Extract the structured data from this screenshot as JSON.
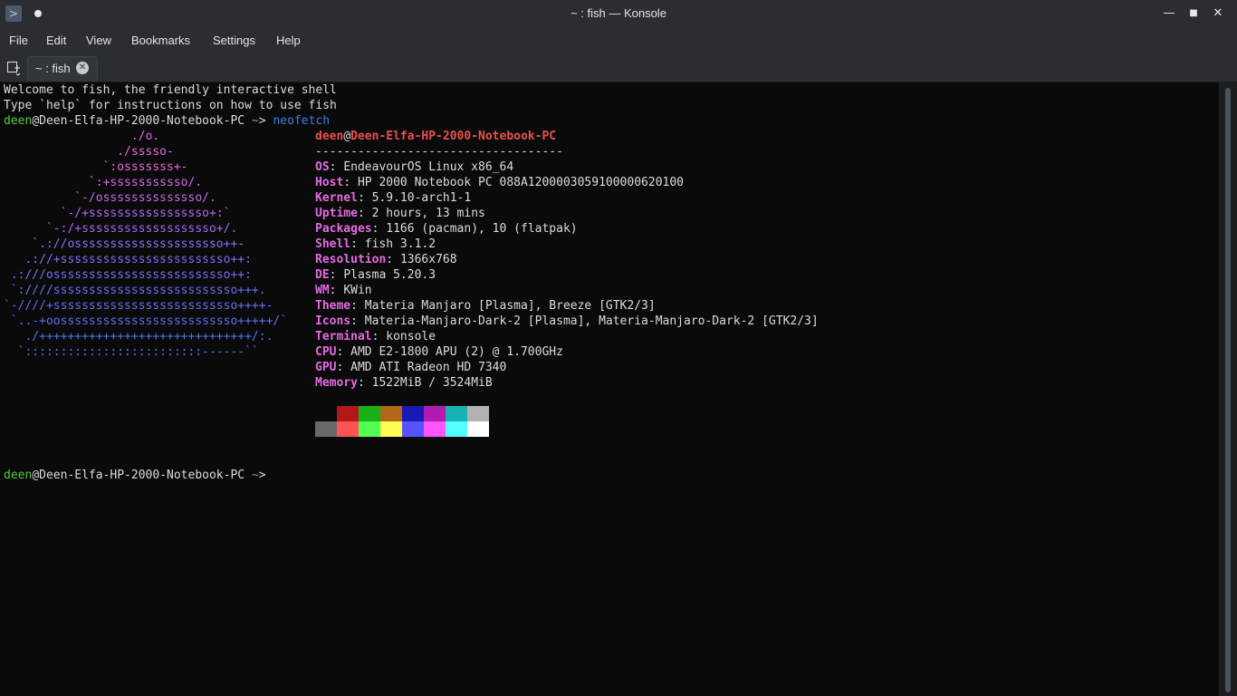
{
  "window": {
    "title": "~ : fish — Konsole",
    "minimize_glyph": "—",
    "maximize_glyph": "■",
    "close_glyph": "✕",
    "app_icon_glyph": ">"
  },
  "menubar": {
    "items": [
      {
        "label": "File"
      },
      {
        "label": "Edit"
      },
      {
        "label": "View"
      },
      {
        "label": "Bookmarks"
      },
      {
        "label": "Settings"
      },
      {
        "label": "Help"
      }
    ]
  },
  "tabs": [
    {
      "label": "~ : fish",
      "close_glyph": "✕"
    }
  ],
  "terminal": {
    "welcome_1": "Welcome to fish, the friendly interactive shell",
    "welcome_2": "Type `help` for instructions on how to use fish",
    "prompt_user": "deen",
    "prompt_host": "@Deen-Elfa-HP-2000-Notebook-PC",
    "prompt_dir": " ~",
    "prompt_symbol": "> ",
    "command": "neofetch",
    "neofetch": {
      "user": "deen",
      "at": "@",
      "host": "Deen-Elfa-HP-2000-Notebook-PC",
      "separator": "-----------------------------------",
      "fields": [
        {
          "key": "OS",
          "value": "EndeavourOS Linux x86_64"
        },
        {
          "key": "Host",
          "value": "HP 2000 Notebook PC 088A1200003059100000620100"
        },
        {
          "key": "Kernel",
          "value": "5.9.10-arch1-1"
        },
        {
          "key": "Uptime",
          "value": "2 hours, 13 mins"
        },
        {
          "key": "Packages",
          "value": "1166 (pacman), 10 (flatpak)"
        },
        {
          "key": "Shell",
          "value": "fish 3.1.2"
        },
        {
          "key": "Resolution",
          "value": "1366x768"
        },
        {
          "key": "DE",
          "value": "Plasma 5.20.3"
        },
        {
          "key": "WM",
          "value": "KWin"
        },
        {
          "key": "Theme",
          "value": "Materia Manjaro [Plasma], Breeze [GTK2/3]"
        },
        {
          "key": "Icons",
          "value": "Materia-Manjaro-Dark-2 [Plasma], Materia-Manjaro-Dark-2 [GTK2/3]"
        },
        {
          "key": "Terminal",
          "value": "konsole"
        },
        {
          "key": "CPU",
          "value": "AMD E2-1800 APU (2) @ 1.700GHz"
        },
        {
          "key": "GPU",
          "value": "AMD ATI Radeon HD 7340"
        },
        {
          "key": "Memory",
          "value": "1522MiB / 3524MiB"
        }
      ],
      "logo": [
        {
          "text": "                  ./o.",
          "color": "#e36be0"
        },
        {
          "text": "                ./sssso-",
          "color": "#e36be0"
        },
        {
          "text": "              `:osssssss+-",
          "color": "#e36be0"
        },
        {
          "text": "            `:+sssssssssso/.",
          "color": "#d36ae8"
        },
        {
          "text": "          `-/ossssssssssssso/.",
          "color": "#c56aef"
        },
        {
          "text": "        `-/+sssssssssssssssso+:`",
          "color": "#b46af2"
        },
        {
          "text": "      `-:/+sssssssssssssssssso+/.",
          "color": "#a06cf2"
        },
        {
          "text": "    `.://osssssssssssssssssssso++-",
          "color": "#926ff2"
        },
        {
          "text": "   .://+ssssssssssssssssssssssso++:",
          "color": "#8270f2"
        },
        {
          "text": " .:///osssssssssssssssssssssssso++:",
          "color": "#7570f2"
        },
        {
          "text": " `:////ssssssssssssssssssssssssso+++.",
          "color": "#6a70f0"
        },
        {
          "text": "`-////+ssssssssssssssssssssssssso++++-",
          "color": "#6470ee"
        },
        {
          "text": " `..-+oosssssssssssssssssssssssso+++++/`",
          "color": "#5a72ec"
        },
        {
          "text": "   ./++++++++++++++++++++++++++++++/:.",
          "color": "#4f74ea"
        },
        {
          "text": "  `:::::::::::::::::::::::::------``",
          "color": "#4776e8"
        }
      ],
      "palette_colors": {
        "row1": [
          "#0a0a0a",
          "#b21818",
          "#18b218",
          "#b26818",
          "#1818b2",
          "#b218b2",
          "#18b2b2",
          "#b2b2b2"
        ],
        "row2": [
          "#686868",
          "#ff5454",
          "#54ff54",
          "#ffff54",
          "#5454ff",
          "#ff54ff",
          "#54ffff",
          "#ffffff"
        ]
      }
    }
  },
  "colors": {
    "prompt_user": "#55c64a",
    "command": "#3f7be6",
    "info_key": "#e36be0",
    "info_host": "#e8504f"
  }
}
